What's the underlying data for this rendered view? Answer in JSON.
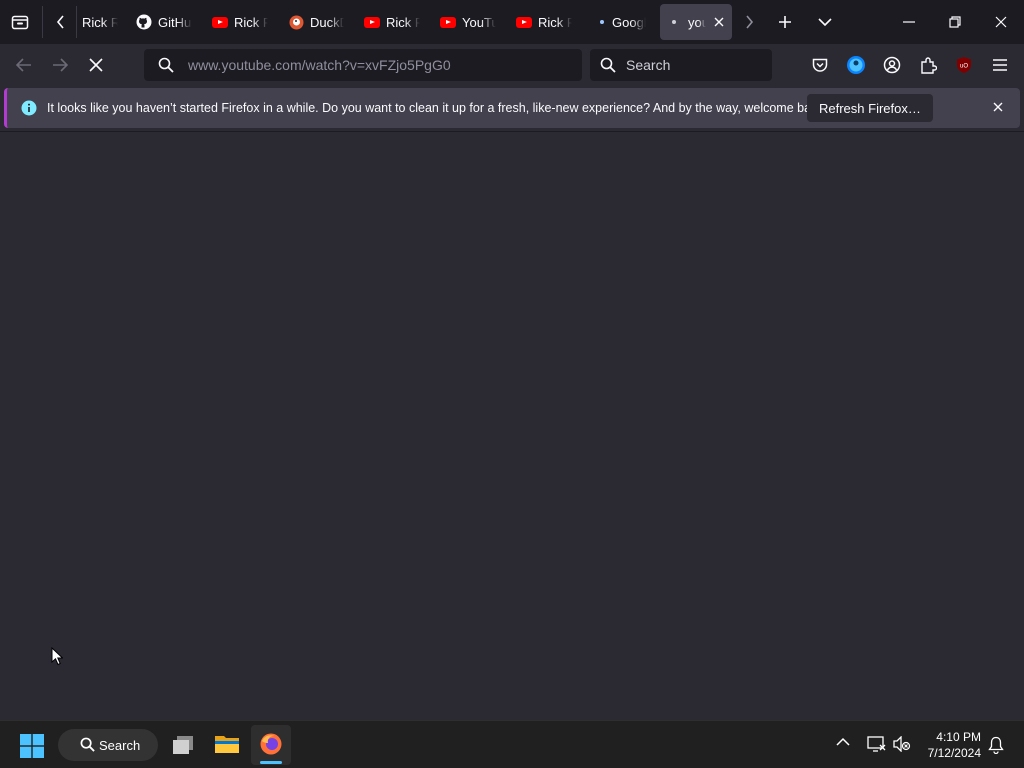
{
  "tabs": [
    {
      "title": "Rick R",
      "icon": "rick-favicon"
    },
    {
      "title": "GitHub",
      "icon": "github-icon"
    },
    {
      "title": "Rick R",
      "icon": "youtube-icon"
    },
    {
      "title": "DuckD",
      "icon": "duckduckgo-icon"
    },
    {
      "title": "Rick R",
      "icon": "youtube-icon"
    },
    {
      "title": "YouTu",
      "icon": "youtube-icon"
    },
    {
      "title": "Rick R",
      "icon": "youtube-icon"
    },
    {
      "title": "Googl",
      "icon": "dot-icon"
    },
    {
      "title": "you",
      "icon": "dot-icon",
      "active": true
    }
  ],
  "navbar": {
    "url_domain": "www.youtube.com",
    "url_path": "/watch?v=xvFZjo5PgG0",
    "search_placeholder": "Search"
  },
  "notification": {
    "message": "It looks like you haven’t started Firefox in a while. Do you want to clean it up for a fresh, like-new experience? And by the way, welcome back!",
    "button_label": "Refresh Firefox…"
  },
  "taskbar": {
    "search_label": "Search",
    "time": "4:10 PM",
    "date": "7/12/2024"
  },
  "colors": {
    "accent": "#b33bd1",
    "info": "#80ebff",
    "youtube_red": "#ff0000",
    "firefox_orange": "#ff7139",
    "windows_blue": "#4cc2ff"
  }
}
